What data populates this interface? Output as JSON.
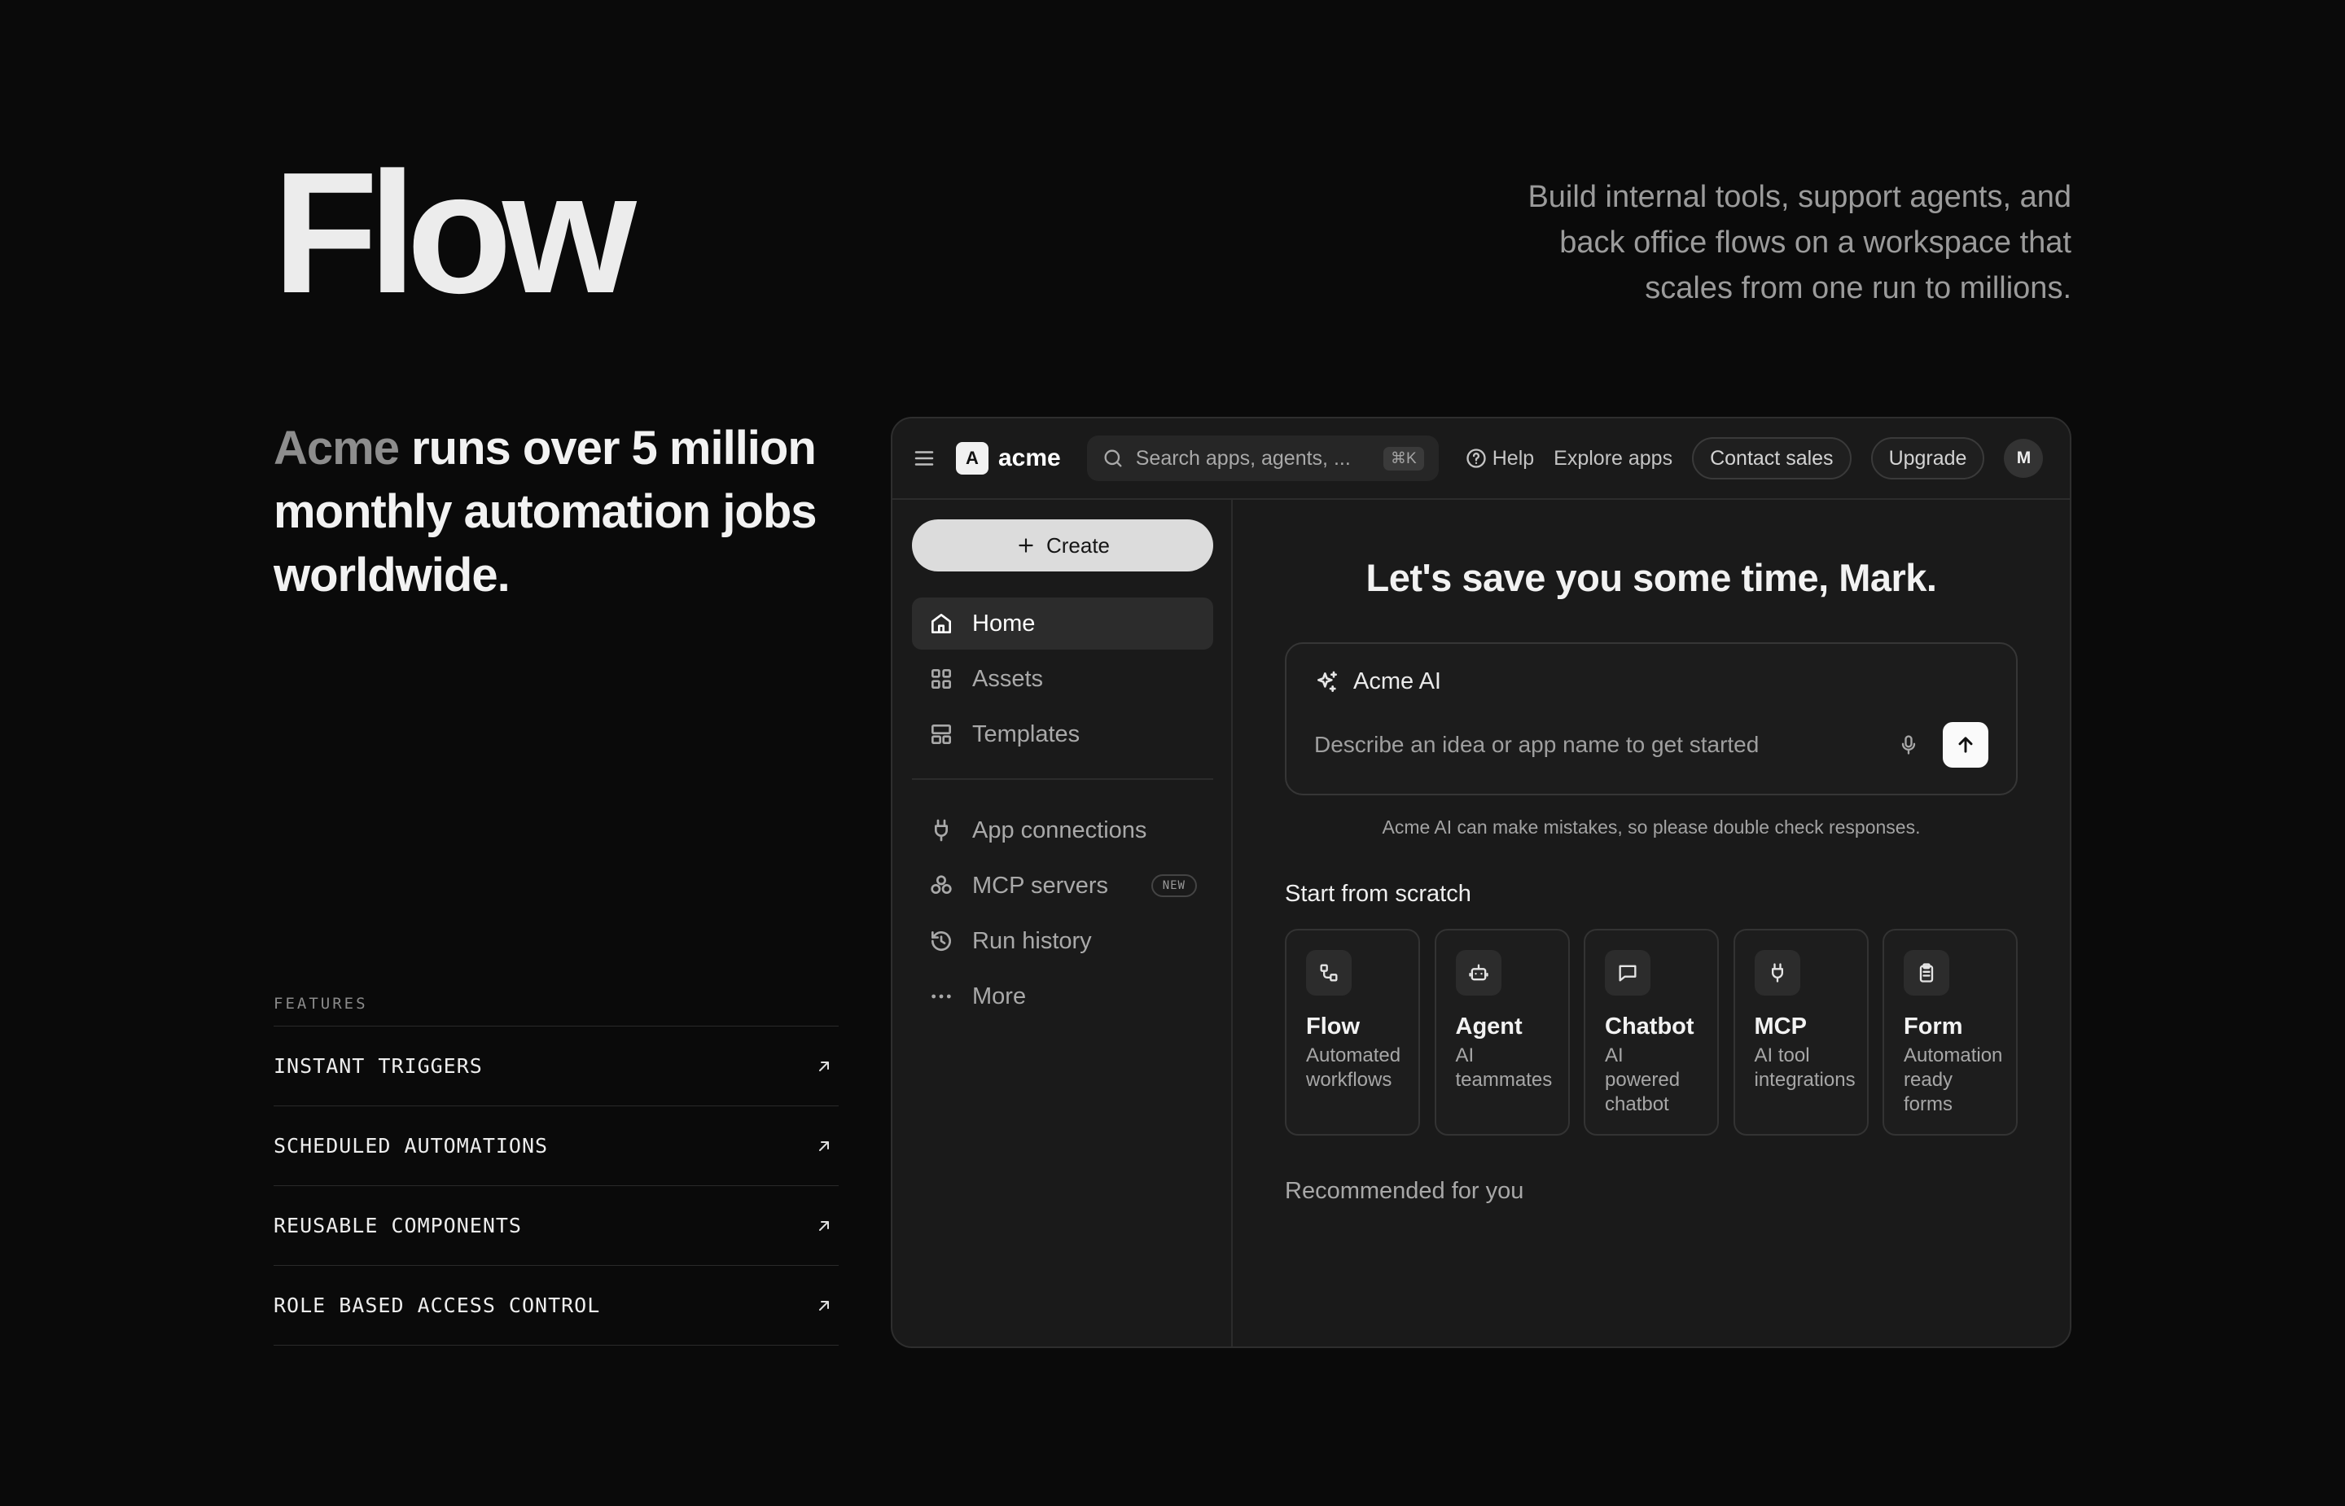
{
  "hero": {
    "title": "Flow",
    "tagline": "Build internal tools, support agents, and back office flows on a workspace that scales from one run to millions.",
    "claim_brand": "Acme",
    "claim_rest": " runs over 5 million monthly automation jobs worldwide."
  },
  "features": {
    "heading": "FEATURES",
    "items": [
      {
        "label": "INSTANT TRIGGERS"
      },
      {
        "label": "SCHEDULED AUTOMATIONS"
      },
      {
        "label": "REUSABLE COMPONENTS"
      },
      {
        "label": "ROLE BASED ACCESS CONTROL"
      }
    ]
  },
  "app": {
    "topbar": {
      "logo_letter": "A",
      "brand": "acme",
      "search_placeholder": "Search apps, agents, ...",
      "search_shortcut": "⌘K",
      "help": "Help",
      "explore": "Explore apps",
      "contact": "Contact sales",
      "upgrade": "Upgrade",
      "avatar": "M"
    },
    "sidebar": {
      "create": "Create",
      "primary": [
        {
          "label": "Home",
          "icon": "home-icon"
        },
        {
          "label": "Assets",
          "icon": "grid-icon"
        },
        {
          "label": "Templates",
          "icon": "layout-icon"
        }
      ],
      "secondary": [
        {
          "label": "App connections",
          "icon": "plug-icon"
        },
        {
          "label": "MCP servers",
          "icon": "boxes-icon",
          "badge": "NEW"
        },
        {
          "label": "Run history",
          "icon": "history-icon"
        },
        {
          "label": "More",
          "icon": "dots-icon"
        }
      ]
    },
    "main": {
      "greeting": "Let's save you some time, Mark.",
      "ai_title": "Acme AI",
      "ai_placeholder": "Describe an idea or app name to get started",
      "disclaimer": "Acme AI can make mistakes, so please double check responses.",
      "scratch_title": "Start from scratch",
      "cards": [
        {
          "title": "Flow",
          "desc": "Automated workflows",
          "icon": "flow-icon"
        },
        {
          "title": "Agent",
          "desc": "AI teammates",
          "icon": "robot-icon"
        },
        {
          "title": "Chatbot",
          "desc": "AI powered chatbot",
          "icon": "chat-icon"
        },
        {
          "title": "MCP",
          "desc": "AI tool integrations",
          "icon": "plug-icon"
        },
        {
          "title": "Form",
          "desc": "Automation ready forms",
          "icon": "clipboard-icon"
        }
      ],
      "recommended": "Recommended for you"
    }
  }
}
